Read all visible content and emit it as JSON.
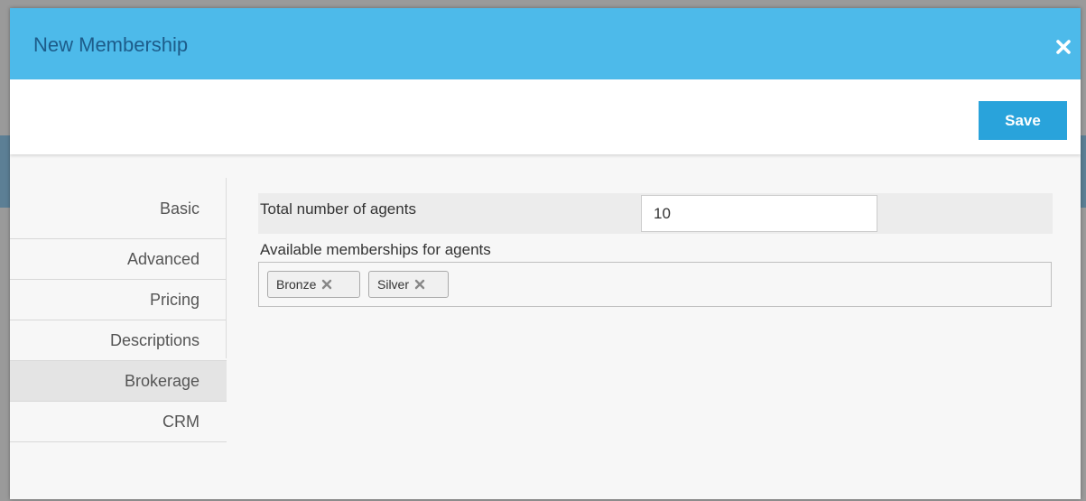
{
  "modal": {
    "title": "New Membership"
  },
  "toolbar": {
    "save_label": "Save"
  },
  "sidebar": {
    "items": [
      {
        "label": "Basic"
      },
      {
        "label": "Advanced"
      },
      {
        "label": "Pricing"
      },
      {
        "label": "Descriptions"
      },
      {
        "label": "Brokerage"
      },
      {
        "label": "CRM"
      }
    ],
    "active": "Brokerage"
  },
  "form": {
    "total_agents_label": "Total number of agents",
    "total_agents_value": "10",
    "available_memberships_label": "Available memberships for agents",
    "tags": [
      {
        "label": "Bronze"
      },
      {
        "label": "Silver"
      }
    ]
  },
  "colors": {
    "header_bg": "#4dbaea",
    "title_color": "#1d5c8a",
    "save_bg": "#29a3db",
    "active_tab_bg": "#e4e4e4"
  },
  "icons": {
    "close": "close-icon",
    "tag_remove": "tag-remove-icon"
  }
}
